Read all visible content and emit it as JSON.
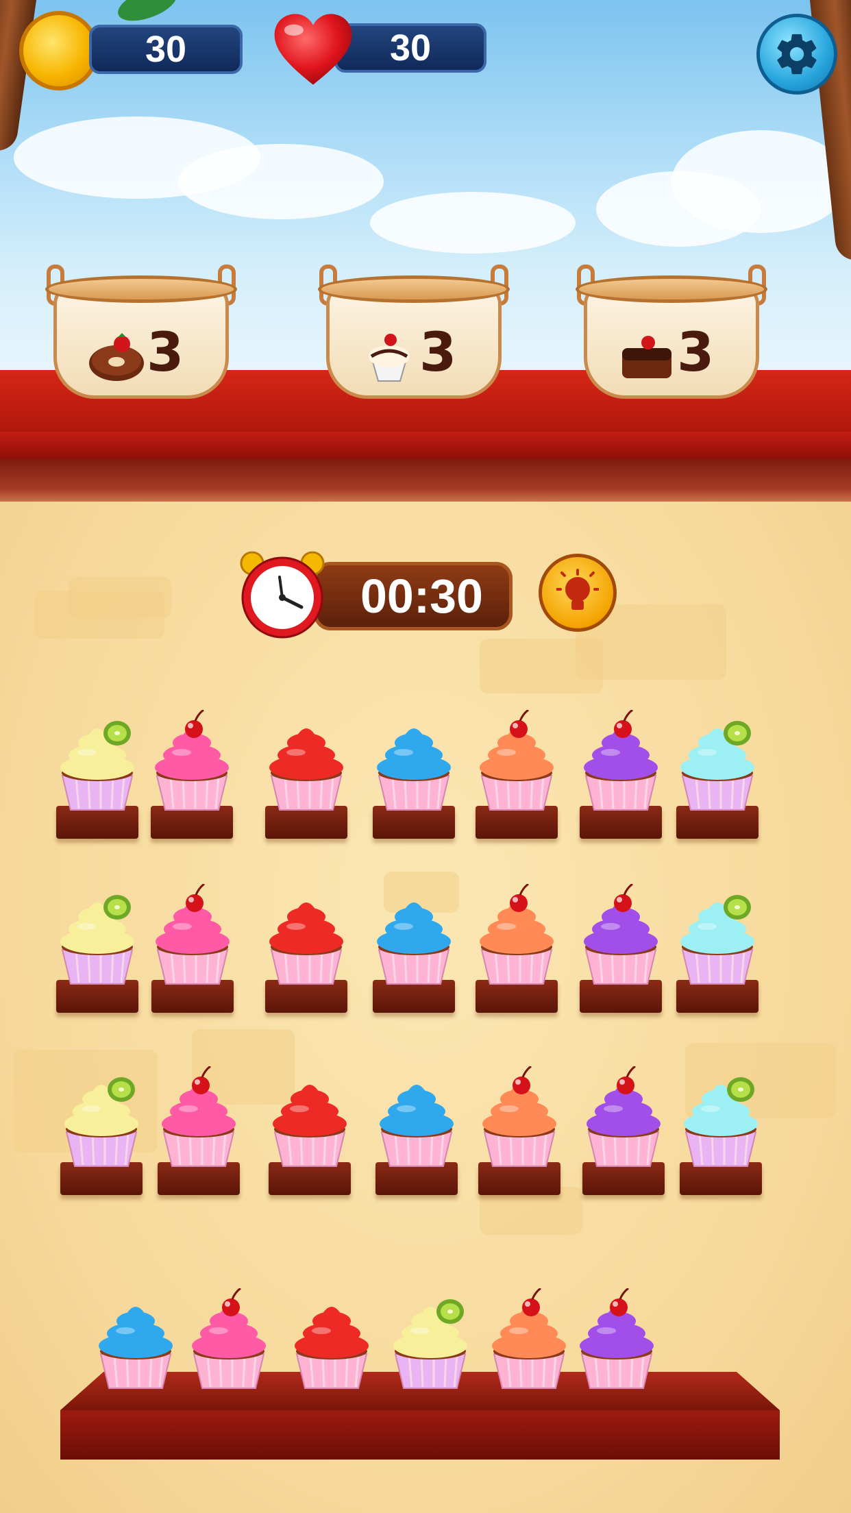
{
  "hud": {
    "coins": "30",
    "lives": "30",
    "icons": [
      "coin-icon",
      "heart-icon",
      "gear-icon"
    ]
  },
  "orders": [
    {
      "food": "donut",
      "count": "3"
    },
    {
      "food": "sundae",
      "count": "3"
    },
    {
      "food": "cake",
      "count": "3"
    }
  ],
  "timer": {
    "value": "00:30"
  },
  "hint": {
    "icon": "lightbulb-icon"
  },
  "cupcake_rows": [
    [
      "kiwi-yellow",
      "cherry-pink",
      "red",
      "blue",
      "cherry-orange",
      "cherry-purple",
      "kiwi-cyan"
    ],
    [
      "kiwi-yellow",
      "cherry-pink",
      "red",
      "blue",
      "cherry-orange",
      "cherry-purple",
      "kiwi-cyan"
    ],
    [
      "kiwi-yellow",
      "cherry-pink",
      "red",
      "blue",
      "cherry-orange",
      "cherry-purple",
      "kiwi-cyan"
    ]
  ],
  "tray": [
    "blue",
    "cherry-pink",
    "red",
    "kiwi-yellow",
    "cherry-orange",
    "cherry-purple"
  ],
  "colors": {
    "kiwi-yellow": "#f7ef9a",
    "cherry-pink": "#ff5aa5",
    "red": "#ee2a26",
    "blue": "#2fa8ee",
    "cherry-orange": "#ff8a55",
    "cherry-purple": "#a24ee8",
    "kiwi-cyan": "#9cf0f4"
  }
}
